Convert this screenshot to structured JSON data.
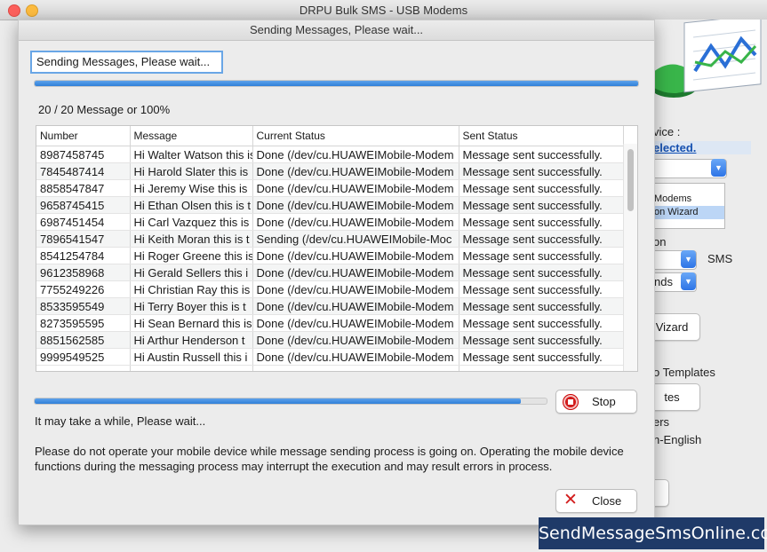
{
  "main_window": {
    "title": "DRPU Bulk SMS - USB Modems",
    "background": {
      "device_label": "vice :",
      "selected_link": "elected.",
      "listbox_items": [
        "Modems",
        "on  Wizard"
      ],
      "option_label": "on",
      "sms_label": "SMS",
      "seconds_value": "nds",
      "wizard_button": "Vizard",
      "templates_label": "o Templates",
      "templates_button": "tes",
      "ers_label": "ers",
      "language_label": "n-English"
    }
  },
  "dialog": {
    "title": "Sending Messages, Please wait...",
    "status_box": "Sending Messages, Please wait...",
    "top_progress_percent": 100,
    "count_label": "20 / 20 Message or 100%",
    "table": {
      "columns": [
        "Number",
        "Message",
        "Current Status",
        "Sent Status"
      ],
      "rows": [
        [
          "8987458745",
          "Hi Walter Watson this is",
          "Done (/dev/cu.HUAWEIMobile-Modem",
          "Message sent successfully."
        ],
        [
          "7845487414",
          "Hi Harold Slater this is",
          "Done (/dev/cu.HUAWEIMobile-Modem",
          "Message sent successfully."
        ],
        [
          "8858547847",
          "Hi Jeremy Wise this is",
          "Done (/dev/cu.HUAWEIMobile-Modem",
          "Message sent successfully."
        ],
        [
          "9658745415",
          "Hi Ethan Olsen this is t",
          "Done (/dev/cu.HUAWEIMobile-Modem",
          "Message sent successfully."
        ],
        [
          "6987451454",
          "Hi Carl Vazquez this is",
          "Done (/dev/cu.HUAWEIMobile-Modem",
          "Message sent successfully."
        ],
        [
          "7896541547",
          "Hi Keith Moran this is t",
          "Sending (/dev/cu.HUAWEIMobile-Moc",
          "Message sent successfully."
        ],
        [
          "8541254784",
          "Hi Roger Greene this is",
          "Done (/dev/cu.HUAWEIMobile-Modem",
          "Message sent successfully."
        ],
        [
          "9612358968",
          "Hi Gerald Sellers this i",
          "Done (/dev/cu.HUAWEIMobile-Modem",
          "Message sent successfully."
        ],
        [
          "7755249226",
          "Hi Christian Ray this is",
          "Done (/dev/cu.HUAWEIMobile-Modem",
          "Message sent successfully."
        ],
        [
          "8533595549",
          "Hi Terry Boyer this is t",
          "Done (/dev/cu.HUAWEIMobile-Modem",
          "Message sent successfully."
        ],
        [
          "8273595595",
          "Hi Sean Bernard this is",
          "Done (/dev/cu.HUAWEIMobile-Modem",
          "Message sent successfully."
        ],
        [
          "8851562585",
          "Hi Arthur Henderson t",
          "Done (/dev/cu.HUAWEIMobile-Modem",
          "Message sent successfully."
        ],
        [
          "9999549525",
          "Hi Austin Russell this i",
          "Done (/dev/cu.HUAWEIMobile-Modem",
          "Message sent successfully."
        ]
      ]
    },
    "bottom_progress_percent": 95,
    "stop_button": "Stop",
    "wait_text": "It may take a while, Please wait...",
    "warning_text": "Please do not operate your mobile device while message sending process is going on. Operating the mobile device functions during the messaging process may interrupt the execution and may result errors in process.",
    "close_button": "Close"
  },
  "watermark": "SendMessageSmsOnline.com",
  "colors": {
    "progress": "#2f7fd8",
    "accent_border": "#69a6e6",
    "icon_red": "#d21b1b",
    "watermark_bg": "#1f3a68"
  },
  "icons": {
    "stop": "stop-icon",
    "close": "close-x-icon",
    "logo": "chart-logo-icon"
  }
}
